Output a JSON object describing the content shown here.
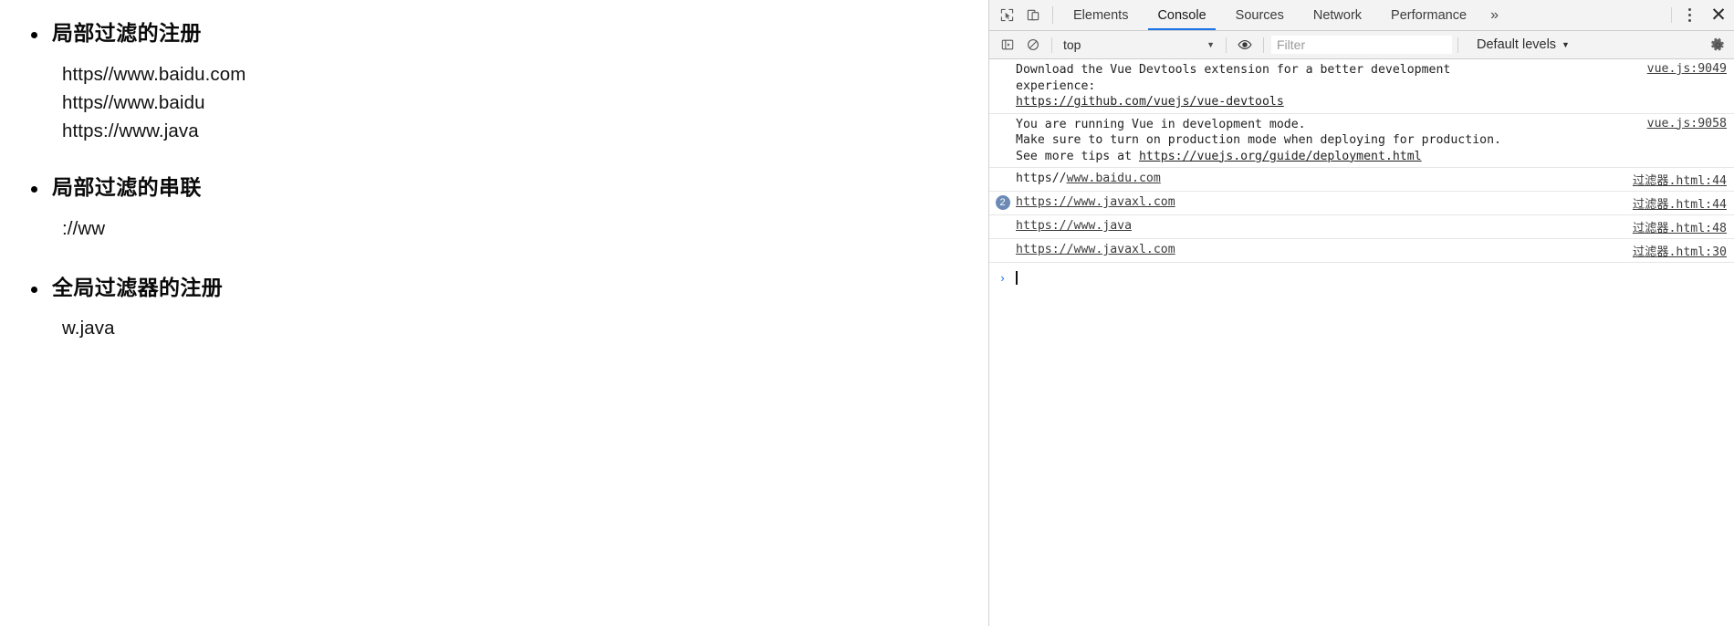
{
  "page": {
    "sections": [
      {
        "title": "局部过滤的注册",
        "lines": [
          "https//www.baidu.com",
          "https//www.baidu",
          "https://www.java"
        ]
      },
      {
        "title": "局部过滤的串联",
        "lines": [
          "://ww"
        ]
      },
      {
        "title": "全局过滤器的注册",
        "lines": [
          "w.java"
        ]
      }
    ]
  },
  "devtools": {
    "tabs": [
      {
        "label": "Elements",
        "active": false
      },
      {
        "label": "Console",
        "active": true
      },
      {
        "label": "Sources",
        "active": false
      },
      {
        "label": "Network",
        "active": false
      },
      {
        "label": "Performance",
        "active": false
      }
    ],
    "more_label": "»",
    "close_label": "✕",
    "icons": {
      "inspect": "inspect-element-icon",
      "device": "device-toolbar-icon",
      "sidebar": "console-sidebar-icon",
      "clear": "clear-console-icon",
      "eye": "live-expression-icon",
      "gear": "settings-gear-icon",
      "kebab": "more-options-icon"
    },
    "filterbar": {
      "context": "top",
      "filter_placeholder": "Filter",
      "filter_value": "",
      "levels": "Default levels",
      "caret": "▼"
    },
    "accent_color": "#1a73e8",
    "badge_color": "#6b8bb5",
    "logs": [
      {
        "count": "",
        "parts": [
          {
            "text": "Download the Vue Devtools extension for a better development\nexperience:\n",
            "kind": "plain"
          },
          {
            "text": "https://github.com/vuejs/vue-devtools",
            "kind": "link"
          }
        ],
        "source": "vue.js:9049"
      },
      {
        "count": "",
        "parts": [
          {
            "text": "You are running Vue in development mode.\nMake sure to turn on production mode when deploying for production.\nSee more tips at ",
            "kind": "plain"
          },
          {
            "text": "https://vuejs.org/guide/deployment.html",
            "kind": "link"
          }
        ],
        "source": "vue.js:9058"
      },
      {
        "count": "",
        "parts": [
          {
            "text": "https//",
            "kind": "plain"
          },
          {
            "text": "www.baidu.com",
            "kind": "link"
          }
        ],
        "source": "过滤器.html:44"
      },
      {
        "count": "2",
        "parts": [
          {
            "text": "https://www.javaxl.com",
            "kind": "link"
          }
        ],
        "source": "过滤器.html:44"
      },
      {
        "count": "",
        "parts": [
          {
            "text": "https://www.java",
            "kind": "link"
          }
        ],
        "source": "过滤器.html:48"
      },
      {
        "count": "",
        "parts": [
          {
            "text": "https://www.javaxl.com",
            "kind": "link"
          }
        ],
        "source": "过滤器.html:30"
      }
    ],
    "prompt": {
      "arrow": "›",
      "value": ""
    }
  }
}
